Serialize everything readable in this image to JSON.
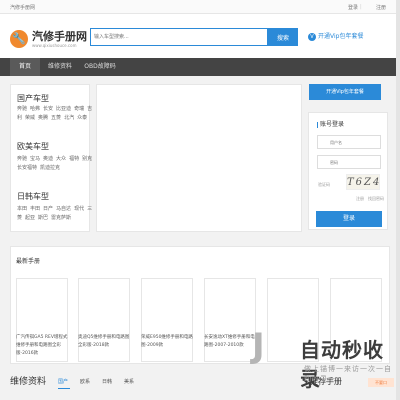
{
  "topbar": {
    "welcome": "汽修手册网",
    "login": "登录",
    "sep": "|",
    "register": "注册"
  },
  "header": {
    "logo_icon": "wrench-icon",
    "title": "汽修手册网",
    "domain": "www.qixiushouce.com",
    "search_placeholder": "输入车型搜索...",
    "search_button": "搜索",
    "vip_link": "开通Vip包年套餐"
  },
  "nav": [
    "首页",
    "维修资料",
    "OBD故障码"
  ],
  "categories": [
    {
      "title": "国产车型",
      "links": [
        "奔驰",
        "哈弗",
        "长安",
        "比亚迪",
        "奇瑞",
        "吉利",
        "荣威",
        "奥腾",
        "五菱",
        "北汽",
        "众泰"
      ]
    },
    {
      "title": "欧美车型",
      "links": [
        "奔驰",
        "宝马",
        "奥迪",
        "大众",
        "福特",
        "别克",
        "长安福特",
        "凯迪拉克"
      ]
    },
    {
      "title": "日韩车型",
      "links": [
        "本田",
        "丰田",
        "日产",
        "马自达",
        "现代",
        "三菱",
        "起亚",
        "斯巴",
        "雷克萨斯"
      ]
    }
  ],
  "vip_button": "开通Vip包年套餐",
  "login_panel": {
    "title": "账号登录",
    "username_placeholder": "用户名",
    "password_placeholder": "密码",
    "captcha_label": "验证码",
    "captcha_text": "T6Z4",
    "register": "注册",
    "forgot": "找回密码",
    "submit": "登录"
  },
  "latest": {
    "title": "最新手册",
    "cards": [
      "广汽传祺GA5 REV增程式维修手册和电路图全彩版-2016款",
      "奥迪Q5维修手册和电路图全彩版-2018款",
      "荣威E950维修手册和电路图-2009款",
      "长安逸动XT维修手册和电路图-2007-2010款",
      "",
      ""
    ]
  },
  "repair": {
    "title": "维修资料",
    "tabs": [
      "国产",
      "欧系",
      "日韩",
      "美系"
    ]
  },
  "recommend": {
    "title": "推荐手册",
    "badge": "不要口"
  },
  "watermark": {
    "icon": "J",
    "title": "自动秒收录",
    "sub": "做上锚博一来访一次一自动收录一"
  },
  "colors": {
    "accent": "#2b8ad8",
    "nav_bg": "#444444",
    "logo": "#f0892e"
  }
}
